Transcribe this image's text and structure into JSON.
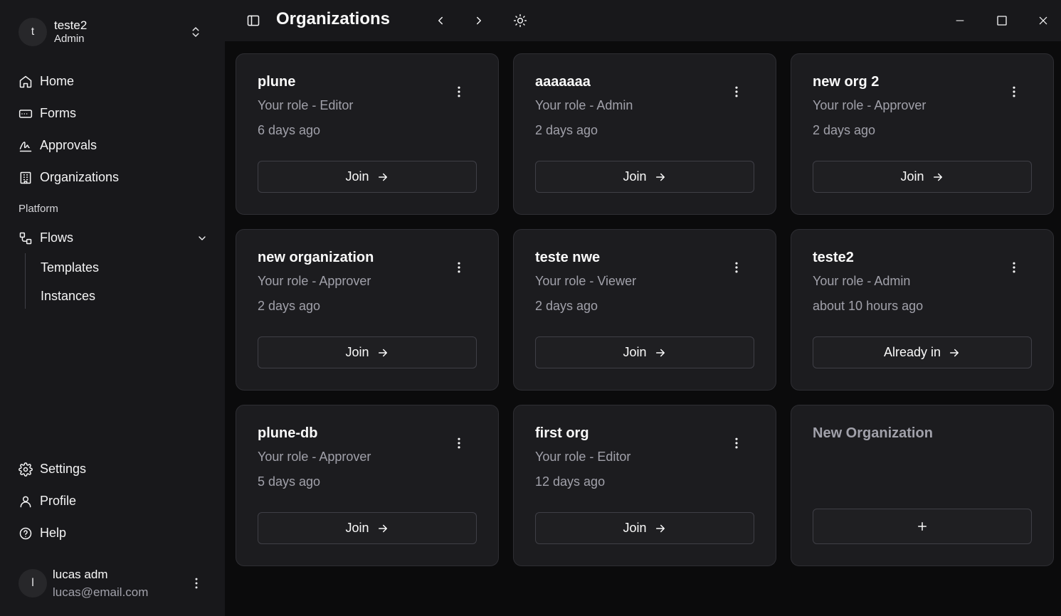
{
  "window": {
    "title": "Organizations",
    "controls": {
      "minimize": "minimize-icon",
      "maximize": "maximize-icon",
      "close": "close-icon"
    }
  },
  "org_switcher": {
    "avatar": "t",
    "name": "teste2",
    "role": "Admin"
  },
  "sidebar": {
    "items": [
      {
        "label": "Home",
        "icon": "home-icon"
      },
      {
        "label": "Forms",
        "icon": "form-icon"
      },
      {
        "label": "Approvals",
        "icon": "signature-icon"
      },
      {
        "label": "Organizations",
        "icon": "building-icon"
      }
    ],
    "section_label": "Platform",
    "flows": {
      "label": "Flows",
      "icon": "flows-icon",
      "children": [
        {
          "label": "Templates"
        },
        {
          "label": "Instances"
        }
      ]
    },
    "bottom_items": [
      {
        "label": "Settings",
        "icon": "gear-icon"
      },
      {
        "label": "Profile",
        "icon": "user-icon"
      },
      {
        "label": "Help",
        "icon": "help-icon"
      }
    ]
  },
  "user": {
    "avatar": "l",
    "name": "lucas adm",
    "email": "lucas@email.com"
  },
  "organizations": [
    {
      "name": "plune",
      "role": "Your role - Editor",
      "time": "6 days ago",
      "action": "Join"
    },
    {
      "name": "aaaaaaa",
      "role": "Your role - Admin",
      "time": "2 days ago",
      "action": "Join"
    },
    {
      "name": "new org 2",
      "role": "Your role - Approver",
      "time": "2 days ago",
      "action": "Join"
    },
    {
      "name": "new organization",
      "role": "Your role - Approver",
      "time": "2 days ago",
      "action": "Join"
    },
    {
      "name": "teste nwe",
      "role": "Your role - Viewer",
      "time": "2 days ago",
      "action": "Join"
    },
    {
      "name": "teste2",
      "role": "Your role - Admin",
      "time": "about 10 hours ago",
      "action": "Already in"
    },
    {
      "name": "plune-db",
      "role": "Your role - Approver",
      "time": "5 days ago",
      "action": "Join"
    },
    {
      "name": "first org",
      "role": "Your role - Editor",
      "time": "12 days ago",
      "action": "Join"
    }
  ],
  "new_org_card": {
    "title": "New Organization",
    "button_icon": "plus-icon"
  },
  "colors": {
    "background": "#0b0b0c",
    "sidebar": "#18181b",
    "card": "#1c1c1f",
    "muted_text": "#a1a1aa"
  }
}
